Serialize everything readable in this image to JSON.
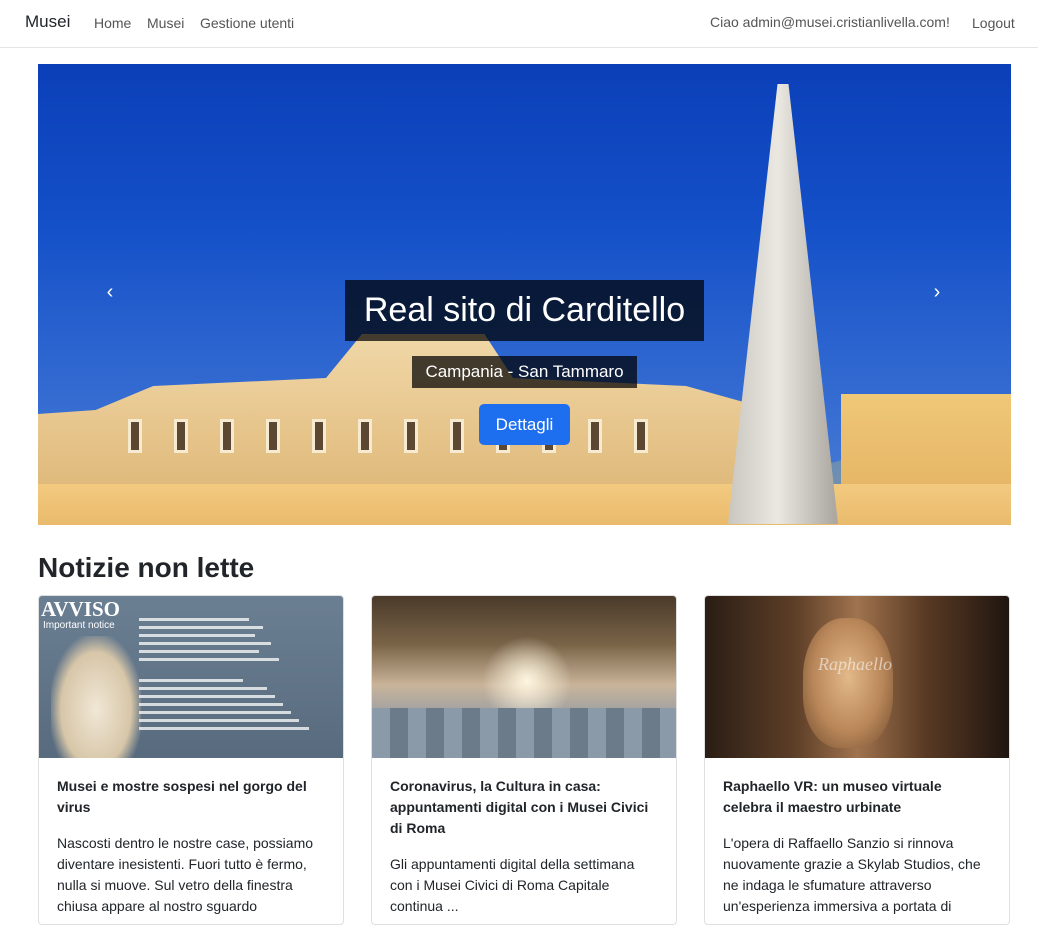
{
  "navbar": {
    "brand": "Musei",
    "links": [
      "Home",
      "Musei",
      "Gestione utenti"
    ],
    "greeting": "Ciao admin@musei.cristianlivella.com!",
    "logout": "Logout"
  },
  "carousel": {
    "title": "Real sito di Carditello",
    "subtitle": "Campania - San Tammaro",
    "button": "Dettagli",
    "prev_label": "Previous",
    "next_label": "Next",
    "prev_icon": "chevron-left-icon",
    "next_icon": "chevron-right-icon"
  },
  "news": {
    "heading": "Notizie non lette",
    "cards": [
      {
        "title": "Musei e mostre sospesi nel gorgo del virus",
        "text": "Nascosti dentro le nostre case, possiamo diventare inesistenti. Fuori tutto è fermo, nulla si muove. Sul vetro della finestra chiusa appare al nostro sguardo",
        "image_heading": "AVVISO",
        "image_subheading": "Important notice"
      },
      {
        "title": "Coronavirus, la Cultura in casa: appuntamenti digital con i Musei Civici di Roma",
        "text": "Gli appuntamenti digital della settimana con i Musei Civici di Roma Capitale continua ..."
      },
      {
        "title": "Raphaello VR: un museo virtuale celebra il maestro urbinate",
        "text": "L'opera di Raffaello Sanzio si rinnova nuovamente grazie a Skylab Studios, che ne indaga le sfumature attraverso un'esperienza immersiva a portata di",
        "image_signature": "Raphaello"
      }
    ]
  },
  "colors": {
    "primary_button": "#1e6ff0",
    "caption_background": "#000000"
  }
}
